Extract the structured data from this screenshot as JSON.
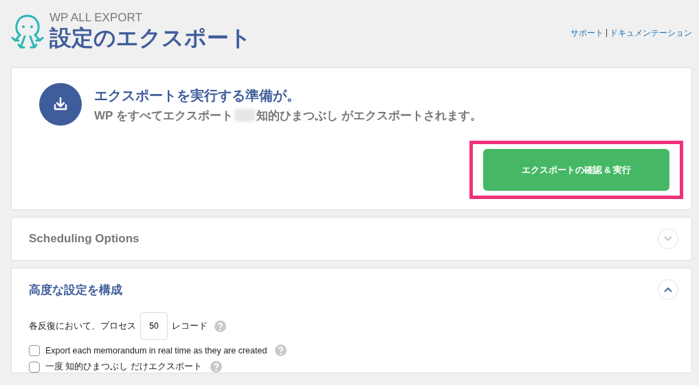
{
  "header": {
    "brand": "WP ALL EXPORT",
    "title": "設定のエクスポート",
    "links": [
      "サポート",
      "ドキュメンテーション"
    ],
    "separator": "|"
  },
  "ready_card": {
    "heading": "エクスポートを実行する準備が。",
    "subtitle_before": "WP をすべてエクスポート",
    "subtitle_after": "知的ひまつぶし がエクスポートされます。",
    "button": "エクスポートの確認 & 実行",
    "highlighted": true
  },
  "sections": [
    {
      "title": "Scheduling Options",
      "expanded": false
    },
    {
      "title": "高度な設定を構成",
      "expanded": true
    }
  ],
  "advanced": {
    "records_label_before": "各反復において、プロセス",
    "records_value": "50",
    "records_label_after": "レコード",
    "options": [
      {
        "label": "Export each memorandum in real time as they are created",
        "checked": false
      },
      {
        "label": "一度 知的ひまつぶし だけエクスポート",
        "checked": false
      }
    ]
  }
}
